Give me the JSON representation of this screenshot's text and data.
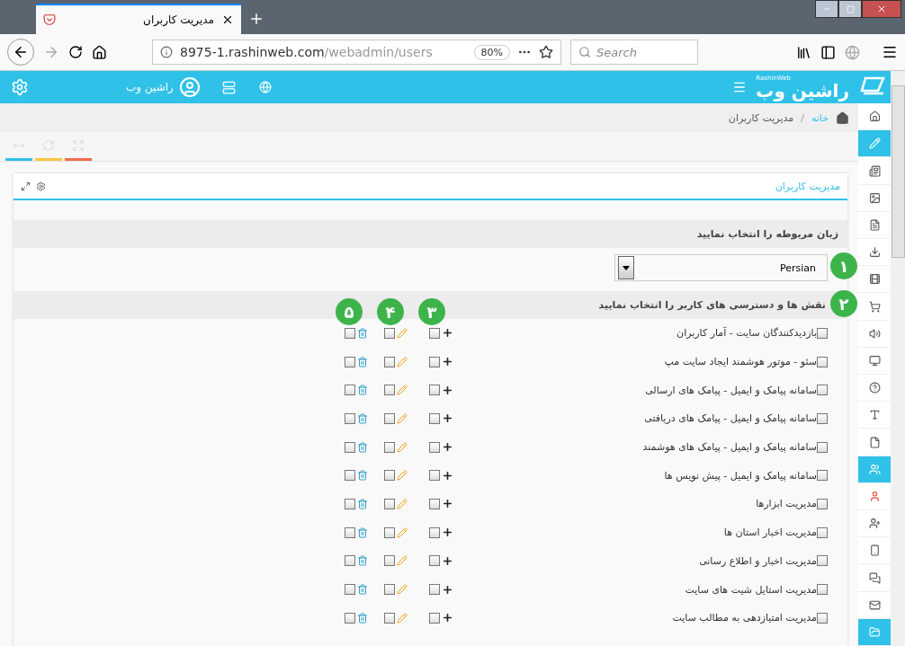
{
  "browser": {
    "tab_title": "مدیریت کاربران",
    "url_host": "8975-1.rashinweb.com",
    "url_path": "/webadmin/users",
    "zoom": "80%",
    "search_placeholder": "Search"
  },
  "header": {
    "logo": "راشین وب",
    "logo_sub": "RashinWeb",
    "user_name": "راشین وب"
  },
  "breadcrumb_separator": "/",
  "breadcrumb": [
    {
      "label": "خانه",
      "kind": "link"
    },
    {
      "label": "مدیریت کاربران",
      "kind": "current"
    }
  ],
  "toolbar": [
    {
      "color": "#2fc1e8"
    },
    {
      "color": "#f9c740"
    },
    {
      "color": "#f26c4f"
    }
  ],
  "card": {
    "title": "مدیریت کاربران",
    "language_heading": "زبان مربوطه را انتخاب نمایید",
    "language_badge": "۱",
    "language_value": "Persian",
    "roles_heading": "نقش ها و دسترسی های کاربر را انتخاب نمایید",
    "roles_badge": "۲",
    "column_badges": [
      "۳",
      "۴",
      "۵"
    ],
    "permissions": [
      {
        "label": "بازدیدکنندگان سایت - آمار کاربران",
        "checked": false,
        "add": false,
        "edit": false,
        "delete": false
      },
      {
        "label": "سئو - موتور هوشمند ایجاد سایت مپ",
        "checked": false,
        "add": false,
        "edit": false,
        "delete": false
      },
      {
        "label": "سامانه پیامک و ایمیل - پیامک های ارسالی",
        "checked": false,
        "add": false,
        "edit": false,
        "delete": false
      },
      {
        "label": "سامانه پیامک و ایمیل - پیامک های دریافتی",
        "checked": false,
        "add": false,
        "edit": false,
        "delete": false
      },
      {
        "label": "سامانه پیامک و ایمیل - پیامک های هوشمند",
        "checked": false,
        "add": false,
        "edit": false,
        "delete": false
      },
      {
        "label": "سامانه پیامک و ایمیل - پیش نویس ها",
        "checked": false,
        "add": false,
        "edit": false,
        "delete": false
      },
      {
        "label": "مدیریت ابزارها",
        "checked": false,
        "add": false,
        "edit": false,
        "delete": false
      },
      {
        "label": "مدیریت اخبار استان ها",
        "checked": false,
        "add": false,
        "edit": false,
        "delete": false
      },
      {
        "label": "مدیریت اخبار و اطلاع رسانی",
        "checked": false,
        "add": false,
        "edit": false,
        "delete": false
      },
      {
        "label": "مدیریت استایل شیت های سایت",
        "checked": false,
        "add": false,
        "edit": false,
        "delete": false
      },
      {
        "label": "مدیریت امتیازدهی به مطالب سایت",
        "checked": false,
        "add": false,
        "edit": false,
        "delete": false
      }
    ]
  },
  "sidebar": {
    "items": [
      {
        "selected": false
      },
      {
        "selected": true
      },
      {
        "selected": false
      },
      {
        "selected": false
      },
      {
        "selected": false
      },
      {
        "selected": false
      },
      {
        "selected": false
      },
      {
        "selected": false
      },
      {
        "selected": false
      },
      {
        "selected": false
      },
      {
        "selected": false
      },
      {
        "selected": false
      },
      {
        "selected": false
      },
      {
        "selected": true
      },
      {
        "selected": false
      },
      {
        "selected": false
      },
      {
        "selected": false
      },
      {
        "selected": false
      },
      {
        "selected": false
      },
      {
        "selected": true
      }
    ]
  }
}
